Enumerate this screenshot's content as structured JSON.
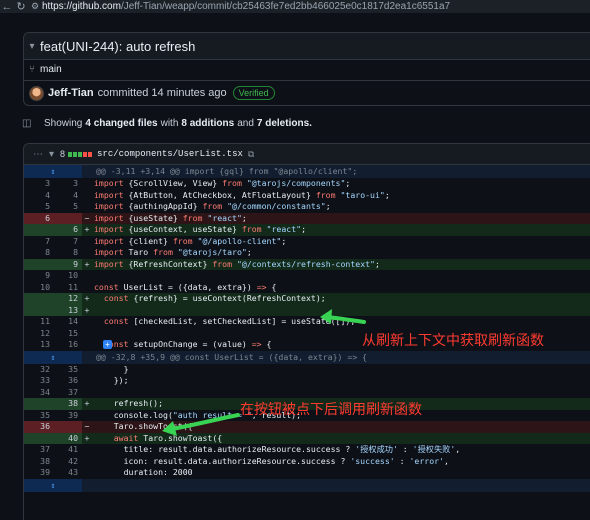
{
  "browser": {
    "url_host": "https://github.com",
    "url_path": "/Jeff-Tian/weapp/commit/cb25463fe7ed2bb466025e0c1817d2ea1c6551a7"
  },
  "commit": {
    "title": "feat(UNI-244): auto refresh",
    "branch": "main",
    "author": "Jeff-Tian",
    "committed_text": "committed 14 minutes ago",
    "verified_label": "Verified"
  },
  "summary": {
    "prefix": "Showing",
    "files_changed": "4 changed files",
    "with": "with",
    "additions": "8 additions",
    "and": "and",
    "deletions": "7 deletions."
  },
  "file": {
    "change_count": "8",
    "path": "src/components/UserList.tsx",
    "diffstat": [
      "add",
      "add",
      "add",
      "del",
      "del"
    ]
  },
  "colors": {
    "add": "#3fb950",
    "del": "#f85149",
    "accent": "#2f81f7",
    "annotation": "#ff3b30",
    "arrow": "#39d353"
  },
  "diff_rows": [
    {
      "type": "hunk",
      "old": "",
      "new": "",
      "mark": "",
      "code": "@@ -3,11 +3,14 @@ import {gql} from \"@apollo/client\";"
    },
    {
      "type": "ctx",
      "old": "3",
      "new": "3",
      "mark": "",
      "code": "import {ScrollView, View} from \"@tarojs/components\";"
    },
    {
      "type": "ctx",
      "old": "4",
      "new": "4",
      "mark": "",
      "code": "import {AtButton, AtCheckbox, AtFloatLayout} from \"taro-ui\";"
    },
    {
      "type": "ctx",
      "old": "5",
      "new": "5",
      "mark": "",
      "code": "import {authingAppId} from \"@/common/constants\";"
    },
    {
      "type": "del",
      "old": "6",
      "new": "",
      "mark": "−",
      "code": "import {useState} from \"react\";"
    },
    {
      "type": "add",
      "old": "",
      "new": "6",
      "mark": "+",
      "code": "import {useContext, useState} from \"react\";"
    },
    {
      "type": "ctx",
      "old": "7",
      "new": "7",
      "mark": "",
      "code": "import {client} from \"@/apollo-client\";"
    },
    {
      "type": "ctx",
      "old": "8",
      "new": "8",
      "mark": "",
      "code": "import Taro from \"@tarojs/taro\";"
    },
    {
      "type": "add",
      "old": "",
      "new": "9",
      "mark": "+",
      "code": "import {RefreshContext} from \"@/contexts/refresh-context\";"
    },
    {
      "type": "ctx",
      "old": "9",
      "new": "10",
      "mark": "",
      "code": ""
    },
    {
      "type": "ctx",
      "old": "10",
      "new": "11",
      "mark": "",
      "code": "const UserList = ({data, extra}) => {"
    },
    {
      "type": "add",
      "old": "",
      "new": "12",
      "mark": "+",
      "code": "  const {refresh} = useContext(RefreshContext);"
    },
    {
      "type": "add",
      "old": "",
      "new": "13",
      "mark": "+",
      "code": ""
    },
    {
      "type": "ctx",
      "old": "11",
      "new": "14",
      "mark": "",
      "code": "  const [checkedList, setCheckedList] = useState([]);"
    },
    {
      "type": "ctx",
      "old": "12",
      "new": "15",
      "mark": "",
      "code": ""
    },
    {
      "type": "ctx",
      "old": "13",
      "new": "16",
      "mark": "",
      "code": "  const setupOnChange = (value) => {"
    },
    {
      "type": "hunk",
      "old": "",
      "new": "",
      "mark": "",
      "code": "@@ -32,8 +35,9 @@ const UserList = ({data, extra}) => {"
    },
    {
      "type": "ctx",
      "old": "32",
      "new": "35",
      "mark": "",
      "code": "      }"
    },
    {
      "type": "ctx",
      "old": "33",
      "new": "36",
      "mark": "",
      "code": "    });"
    },
    {
      "type": "ctx",
      "old": "34",
      "new": "37",
      "mark": "",
      "code": ""
    },
    {
      "type": "add",
      "old": "",
      "new": "38",
      "mark": "+",
      "code": "    refresh();"
    },
    {
      "type": "ctx",
      "old": "35",
      "new": "39",
      "mark": "",
      "code": "    console.log(\"auth result = \", result);"
    },
    {
      "type": "del",
      "old": "36",
      "new": "",
      "mark": "−",
      "code": "    Taro.showToast({"
    },
    {
      "type": "add",
      "old": "",
      "new": "40",
      "mark": "+",
      "code": "    await Taro.showToast({"
    },
    {
      "type": "ctx",
      "old": "37",
      "new": "41",
      "mark": "",
      "code": "      title: result.data.authorizeResource.success ? '授权成功' : '授权失败',"
    },
    {
      "type": "ctx",
      "old": "38",
      "new": "42",
      "mark": "",
      "code": "      icon: result.data.authorizeResource.success ? 'success' : 'error',"
    },
    {
      "type": "ctx",
      "old": "39",
      "new": "43",
      "mark": "",
      "code": "      duration: 2000"
    }
  ],
  "annotations": {
    "first": "从刷新上下文中获取刷新函数",
    "second": "在按钮被点下后调用刷新函数"
  }
}
